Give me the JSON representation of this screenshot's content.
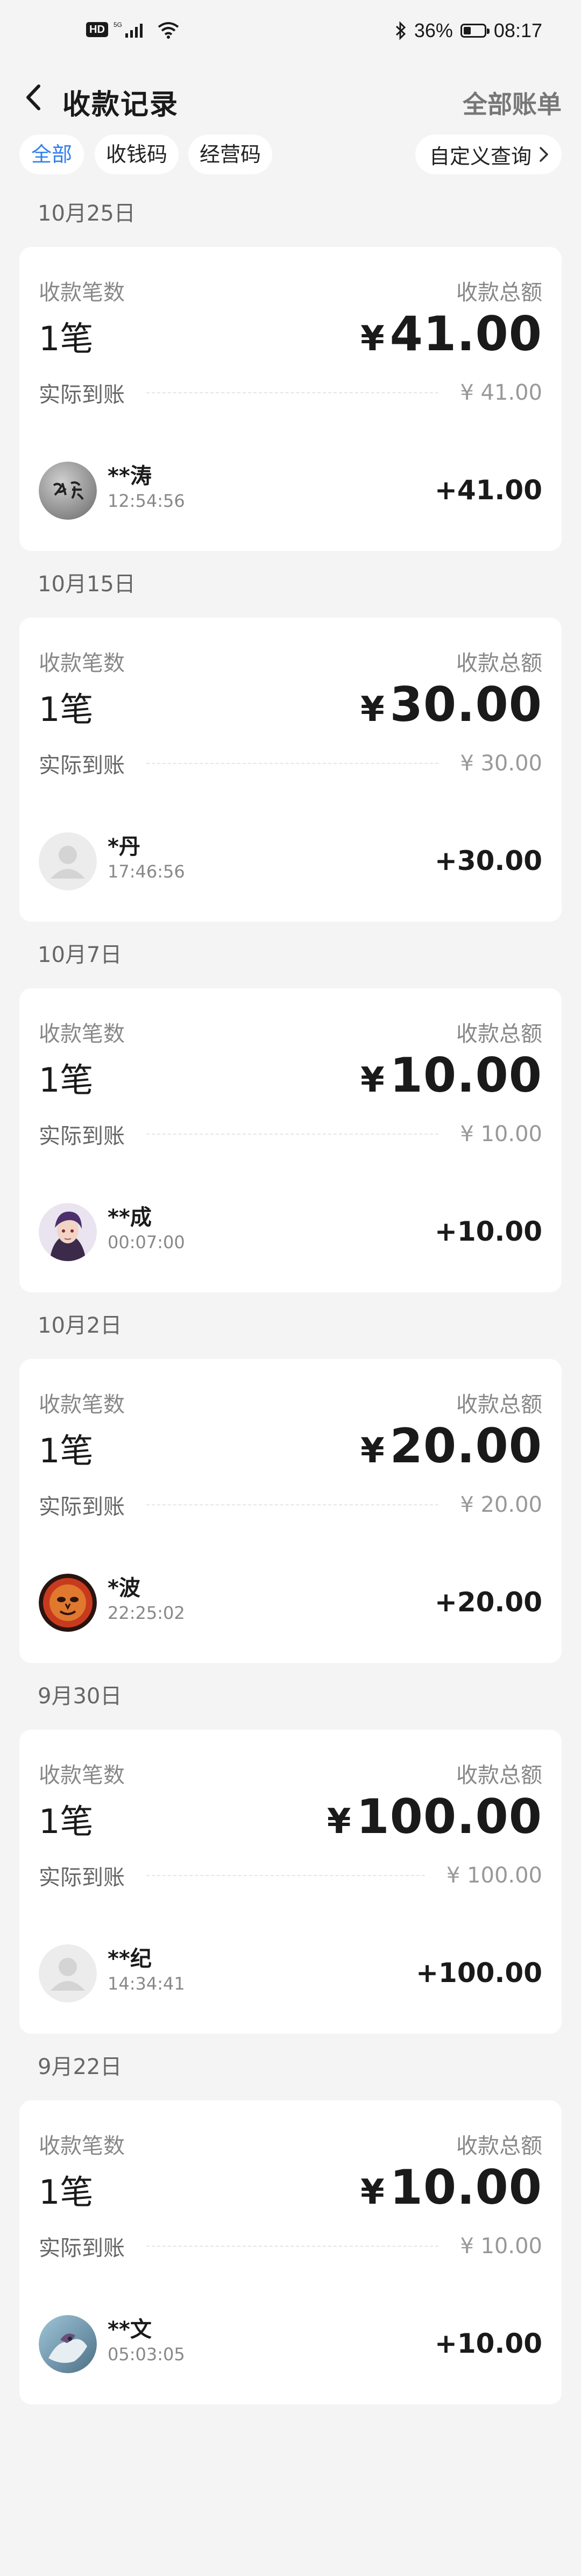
{
  "status_bar": {
    "hd": "HD",
    "signal_type": "5G",
    "battery_percent": "36%",
    "battery_level": 0.36,
    "time": "08:17"
  },
  "header": {
    "title": "收款记录",
    "right_link": "全部账单"
  },
  "filters": {
    "tabs": [
      "全部",
      "收钱码",
      "经营码"
    ],
    "active_index": 0,
    "custom_query": "自定义查询"
  },
  "labels": {
    "count_label": "收款笔数",
    "total_label": "收款总额",
    "actual_label": "实际到账"
  },
  "groups": [
    {
      "date": "10月25日",
      "count": "1笔",
      "yen": "¥",
      "total": "41.00",
      "actual": "¥ 41.00",
      "payer": {
        "name": "**涛",
        "time": "12:54:56",
        "amount": "+41.00",
        "avatar": "stone-calligraphy"
      }
    },
    {
      "date": "10月15日",
      "count": "1笔",
      "yen": "¥",
      "total": "30.00",
      "actual": "¥ 30.00",
      "payer": {
        "name": "*丹",
        "time": "17:46:56",
        "amount": "+30.00",
        "avatar": "default-person"
      }
    },
    {
      "date": "10月7日",
      "count": "1笔",
      "yen": "¥",
      "total": "10.00",
      "actual": "¥ 10.00",
      "payer": {
        "name": "**成",
        "time": "00:07:00",
        "amount": "+10.00",
        "avatar": "anime-character"
      }
    },
    {
      "date": "10月2日",
      "count": "1笔",
      "yen": "¥",
      "total": "20.00",
      "actual": "¥ 20.00",
      "payer": {
        "name": "*波",
        "time": "22:25:02",
        "amount": "+20.00",
        "avatar": "red-sun-face"
      }
    },
    {
      "date": "9月30日",
      "count": "1笔",
      "yen": "¥",
      "total": "100.00",
      "actual": "¥ 100.00",
      "payer": {
        "name": "**纪",
        "time": "14:34:41",
        "amount": "+100.00",
        "avatar": "default-person"
      }
    },
    {
      "date": "9月22日",
      "count": "1笔",
      "yen": "¥",
      "total": "10.00",
      "actual": "¥ 10.00",
      "payer": {
        "name": "**文",
        "time": "05:03:05",
        "amount": "+10.00",
        "avatar": "fantasy-art"
      }
    }
  ],
  "colors": {
    "accent": "#2f80ed",
    "background": "#f4f4f4",
    "card": "#ffffff"
  }
}
